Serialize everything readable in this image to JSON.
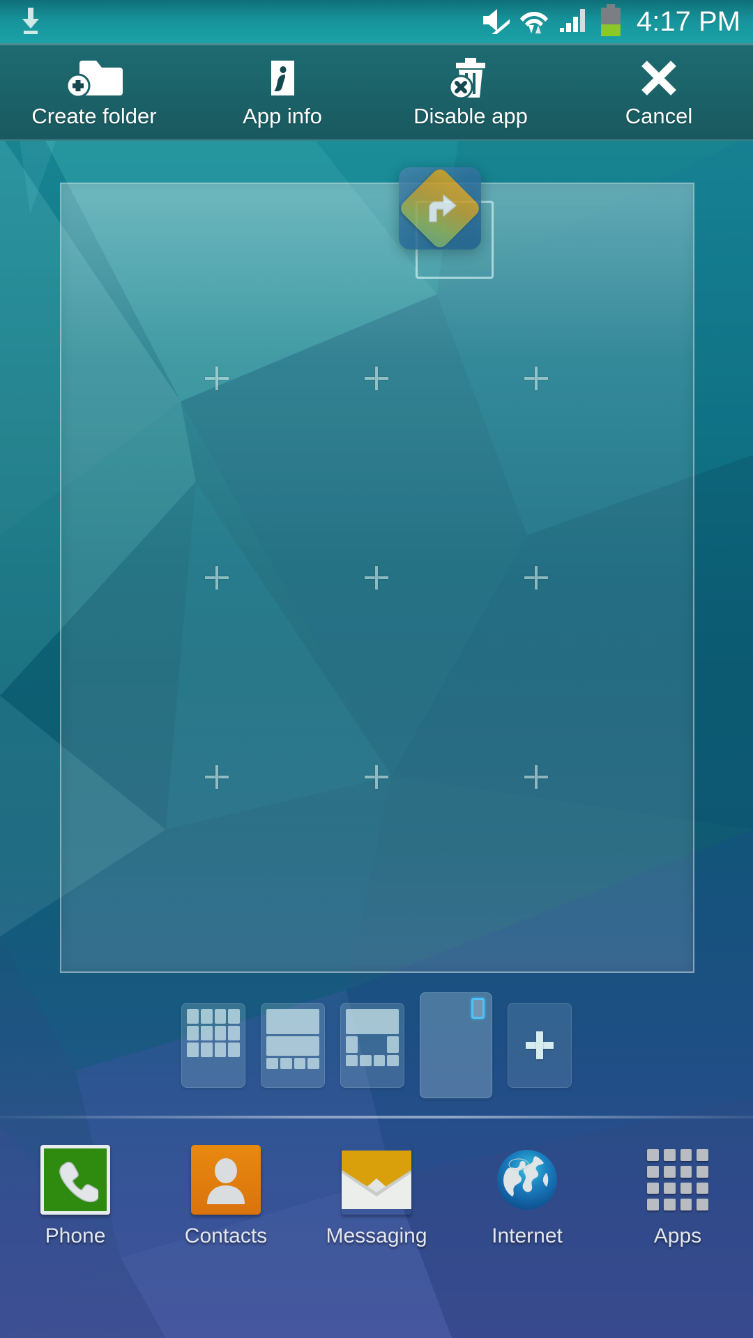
{
  "status_bar": {
    "time": "4:17 PM",
    "left_icons": [
      {
        "name": "download-icon",
        "label": "Download"
      }
    ],
    "right_icons": [
      {
        "name": "mute-icon",
        "label": "Sound muted"
      },
      {
        "name": "wifi-icon",
        "label": "Wi-Fi connected"
      },
      {
        "name": "signal-icon",
        "label": "Cellular signal"
      },
      {
        "name": "battery-icon",
        "label": "Battery",
        "level_percent": 40
      }
    ]
  },
  "action_bar": {
    "items": [
      {
        "label": "Create folder",
        "icon": "folder-add-icon"
      },
      {
        "label": "App info",
        "icon": "info-icon"
      },
      {
        "label": "Disable app",
        "icon": "trash-disable-icon"
      },
      {
        "label": "Cancel",
        "icon": "close-icon"
      }
    ]
  },
  "home_page": {
    "dragged_app": {
      "name": "Navigation",
      "icon": "navigation-turn-right-icon"
    },
    "drop_target_visible": true,
    "grid_markers": 9
  },
  "page_strip": {
    "pages": [
      {
        "index": 1,
        "active": false,
        "layout": "apps-grid"
      },
      {
        "index": 2,
        "active": false,
        "layout": "widget-widget-apps"
      },
      {
        "index": 3,
        "active": false,
        "layout": "widget-split-apps"
      },
      {
        "index": 4,
        "active": true,
        "layout": "single-icon"
      },
      {
        "index": 5,
        "active": false,
        "layout": "add-page",
        "label_icon": "plus-icon"
      }
    ]
  },
  "dock": {
    "items": [
      {
        "label": "Phone",
        "icon": "phone-icon"
      },
      {
        "label": "Contacts",
        "icon": "contacts-icon"
      },
      {
        "label": "Messaging",
        "icon": "messaging-icon"
      },
      {
        "label": "Internet",
        "icon": "internet-globe-icon"
      },
      {
        "label": "Apps",
        "icon": "apps-grid-icon"
      }
    ]
  },
  "colors": {
    "status_bar_teal": "#17949b",
    "action_bar_teal": "#1b6268",
    "accent_blue": "#4fc3f7",
    "battery_green": "#8ac926",
    "phone_green": "#2e8b0f",
    "contacts_orange": "#e8890f"
  }
}
